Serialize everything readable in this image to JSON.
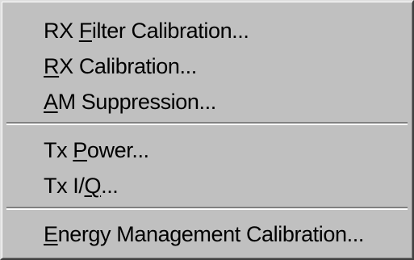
{
  "menu": {
    "items": [
      {
        "pre": "RX ",
        "key": "F",
        "post": "ilter Calibration..."
      },
      {
        "pre": "",
        "key": "R",
        "post": "X Calibration..."
      },
      {
        "pre": "",
        "key": "A",
        "post": "M Suppression..."
      },
      {
        "pre": "Tx ",
        "key": "P",
        "post": "ower..."
      },
      {
        "pre": "Tx I/",
        "key": "Q",
        "post": "..."
      },
      {
        "pre": "",
        "key": "E",
        "post": "nergy Management Calibration..."
      }
    ]
  }
}
